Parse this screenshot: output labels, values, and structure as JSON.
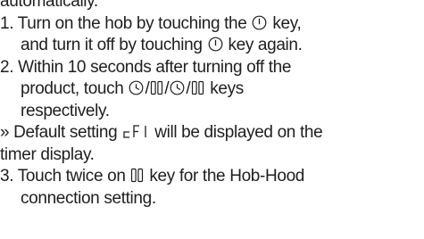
{
  "page": {
    "top_fragment": "automatically.",
    "steps": [
      {
        "number": "1.",
        "line1_before": "Turn on the hob by touching the",
        "line1_after": "key,",
        "line2_before": "and turn it off by touching",
        "line2_after": "key again."
      },
      {
        "number": "2.",
        "line1": "Within 10 seconds after turning off the",
        "line2_before": "product, touch",
        "line2_sep1": "/",
        "line2_sep2": "/",
        "line2_sep3": "/",
        "line2_after": "keys",
        "line3": "respectively."
      },
      {
        "number": "3.",
        "line1_before": "Touch twice on",
        "line1_after": "key for the Hob-Hood",
        "line2": "connection setting."
      }
    ],
    "note": {
      "marker": "»",
      "line1_before": "Default setting",
      "display_code": "cFI",
      "line1_after": "will be displayed on the",
      "line2": "timer display."
    },
    "icons": [
      "power-icon",
      "timer-icon",
      "pause-icon",
      "timer-icon",
      "pause-icon",
      "pause-icon"
    ],
    "colors": {
      "text": "#1e1e1e",
      "background": "#ffffff"
    }
  }
}
